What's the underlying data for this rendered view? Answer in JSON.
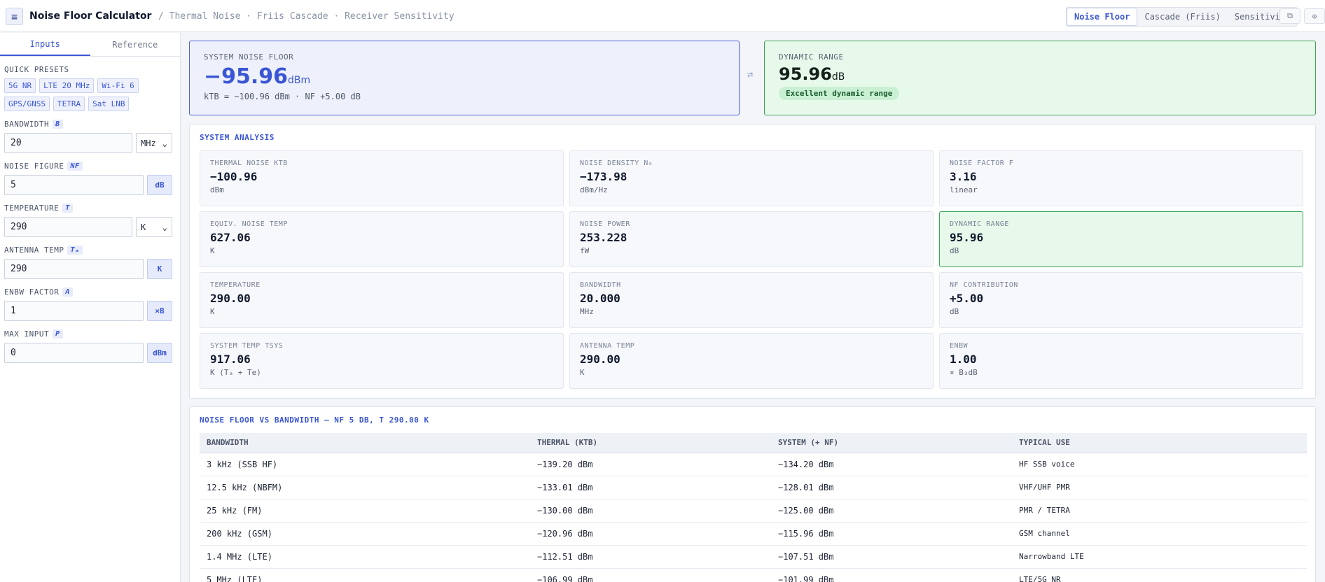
{
  "header": {
    "menu_icon": "≡",
    "title": "Noise Floor Calculator",
    "breadcrumb": "/ Thermal Noise · Friis Cascade · Receiver Sensitivity",
    "modes": [
      "Noise Floor",
      "Cascade (Friis)",
      "Sensitivity"
    ],
    "active_mode": "Noise Floor",
    "copy_icon": "⧉",
    "help_icon": "⊙"
  },
  "sidebar": {
    "tabs": [
      "Inputs",
      "Reference"
    ],
    "active_tab": "Inputs",
    "presets_label": "QUICK PRESETS",
    "presets": [
      "5G NR",
      "LTE 20 MHz",
      "Wi-Fi 6",
      "GPS/GNSS",
      "TETRA",
      "Sat LNB"
    ],
    "fields": {
      "bandwidth": {
        "label": "BANDWIDTH",
        "symbol": "B",
        "value": "20",
        "unit": "MHz",
        "unit_caret": "⌄"
      },
      "noise_figure": {
        "label": "NOISE FIGURE",
        "symbol": "NF",
        "value": "5",
        "unit": "dB"
      },
      "temperature": {
        "label": "TEMPERATURE",
        "symbol": "T",
        "value": "290",
        "unit": "K",
        "unit_caret": "⌄"
      },
      "antenna_temp": {
        "label": "ANTENNA TEMP",
        "symbol": "Tₐ",
        "value": "290",
        "unit": "K"
      },
      "enbw_factor": {
        "label": "ENBW FACTOR",
        "symbol": "A",
        "value": "1",
        "unit": "×B"
      },
      "max_input": {
        "label": "MAX INPUT",
        "symbol": "P",
        "value": "0",
        "unit": "dBm"
      }
    }
  },
  "hero": {
    "noise_floor": {
      "label": "SYSTEM NOISE FLOOR",
      "value": "−95.96",
      "unit": "dBm",
      "sub": "kTB = −100.96 dBm · NF +5.00 dB"
    },
    "swap_icon": "⇄",
    "dynamic_range": {
      "label": "DYNAMIC RANGE",
      "value": "95.96",
      "unit": "dB",
      "badge": "Excellent dynamic range"
    }
  },
  "analysis": {
    "title": "SYSTEM ANALYSIS",
    "cards": [
      {
        "label": "THERMAL NOISE KTB",
        "value": "−100.96",
        "unit": "dBm"
      },
      {
        "label": "NOISE DENSITY N₀",
        "value": "−173.98",
        "unit": "dBm/Hz"
      },
      {
        "label": "NOISE FACTOR F",
        "value": "3.16",
        "unit": "linear"
      },
      {
        "label": "EQUIV. NOISE TEMP",
        "value": "627.06",
        "unit": "K"
      },
      {
        "label": "NOISE POWER",
        "value": "253.228",
        "unit": "fW"
      },
      {
        "label": "DYNAMIC RANGE",
        "value": "95.96",
        "unit": "dB"
      },
      {
        "label": "TEMPERATURE",
        "value": "290.00",
        "unit": "K"
      },
      {
        "label": "BANDWIDTH",
        "value": "20.000",
        "unit": "MHz"
      },
      {
        "label": "NF CONTRIBUTION",
        "value": "+5.00",
        "unit": "dB"
      },
      {
        "label": "SYSTEM TEMP TSYS",
        "value": "917.06",
        "unit": "K (Tₐ + Te)"
      },
      {
        "label": "ANTENNA TEMP",
        "value": "290.00",
        "unit": "K"
      },
      {
        "label": "ENBW",
        "value": "1.00",
        "unit": "× B₃dB"
      }
    ]
  },
  "bandwidth_table": {
    "title": "NOISE FLOOR VS BANDWIDTH — NF 5 DB, T 290.00 K",
    "columns": [
      "BANDWIDTH",
      "THERMAL (KTB)",
      "SYSTEM (+ NF)",
      "TYPICAL USE"
    ],
    "rows": [
      [
        "3 kHz (SSB HF)",
        "−139.20 dBm",
        "−134.20 dBm",
        "HF SSB voice"
      ],
      [
        "12.5 kHz (NBFM)",
        "−133.01 dBm",
        "−128.01 dBm",
        "VHF/UHF PMR"
      ],
      [
        "25 kHz (FM)",
        "−130.00 dBm",
        "−125.00 dBm",
        "PMR / TETRA"
      ],
      [
        "200 kHz (GSM)",
        "−120.96 dBm",
        "−115.96 dBm",
        "GSM channel"
      ],
      [
        "1.4 MHz (LTE)",
        "−112.51 dBm",
        "−107.51 dBm",
        "Narrowband LTE"
      ],
      [
        "5 MHz (LTE)",
        "−106.99 dBm",
        "−101.99 dBm",
        "LTE/5G NR"
      ]
    ]
  }
}
